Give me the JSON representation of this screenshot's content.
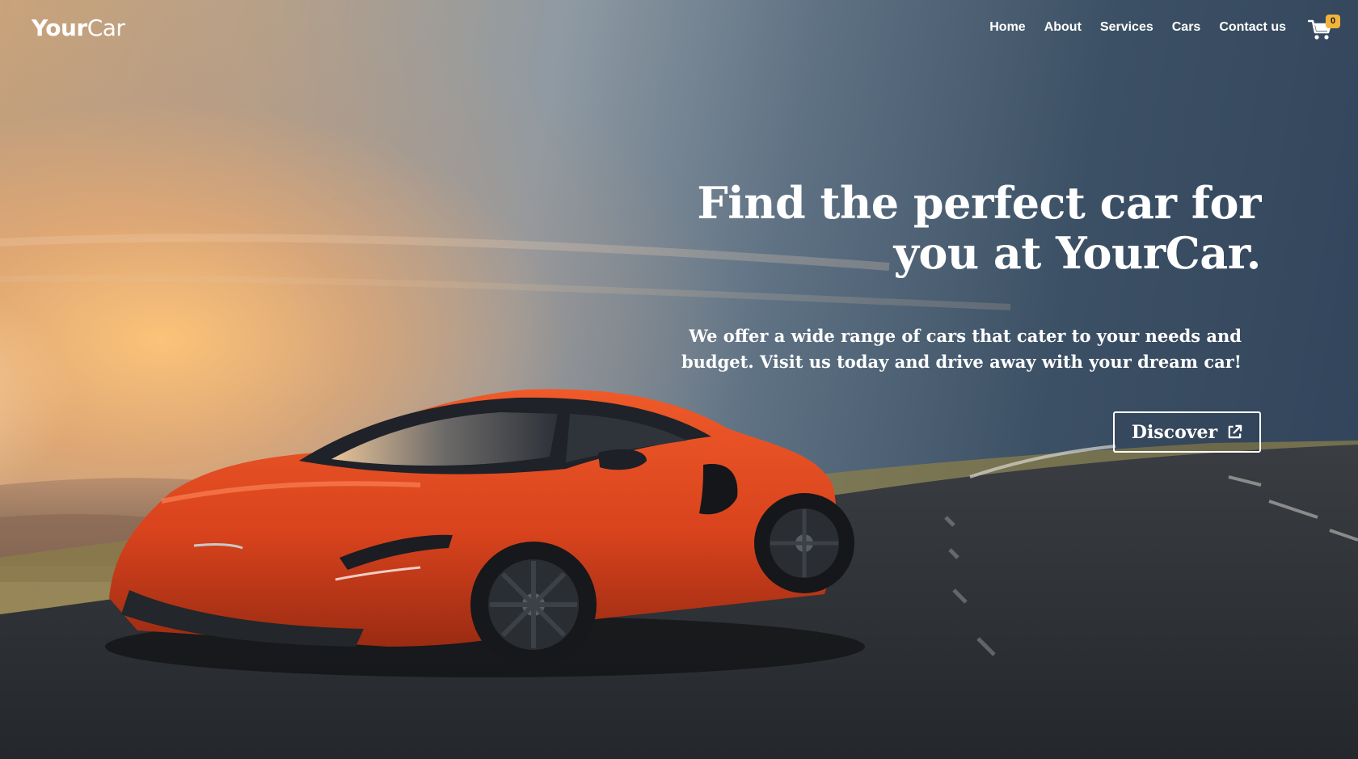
{
  "brand": {
    "logo_part1": "Your",
    "logo_part2": "Car"
  },
  "nav": {
    "items": [
      {
        "label": "Home"
      },
      {
        "label": "About"
      },
      {
        "label": "Services"
      },
      {
        "label": "Cars"
      },
      {
        "label": "Contact us"
      }
    ],
    "cart_icon": "shopping-cart-icon",
    "cart_count": "0"
  },
  "hero": {
    "headline_line1": "Find the perfect car for",
    "headline_line2": "you at YourCar.",
    "subtext": "We offer a wide range of cars that cater to your needs and budget. Visit us today and drive away with your dream car!",
    "cta_label": "Discover",
    "cta_icon": "external-link-icon",
    "background_image": "orange-sports-car-on-road-at-sunset"
  },
  "colors": {
    "text": "#ffffff",
    "badge": "#f2b33d",
    "car": "#d9431d",
    "road": "#2e3135"
  }
}
